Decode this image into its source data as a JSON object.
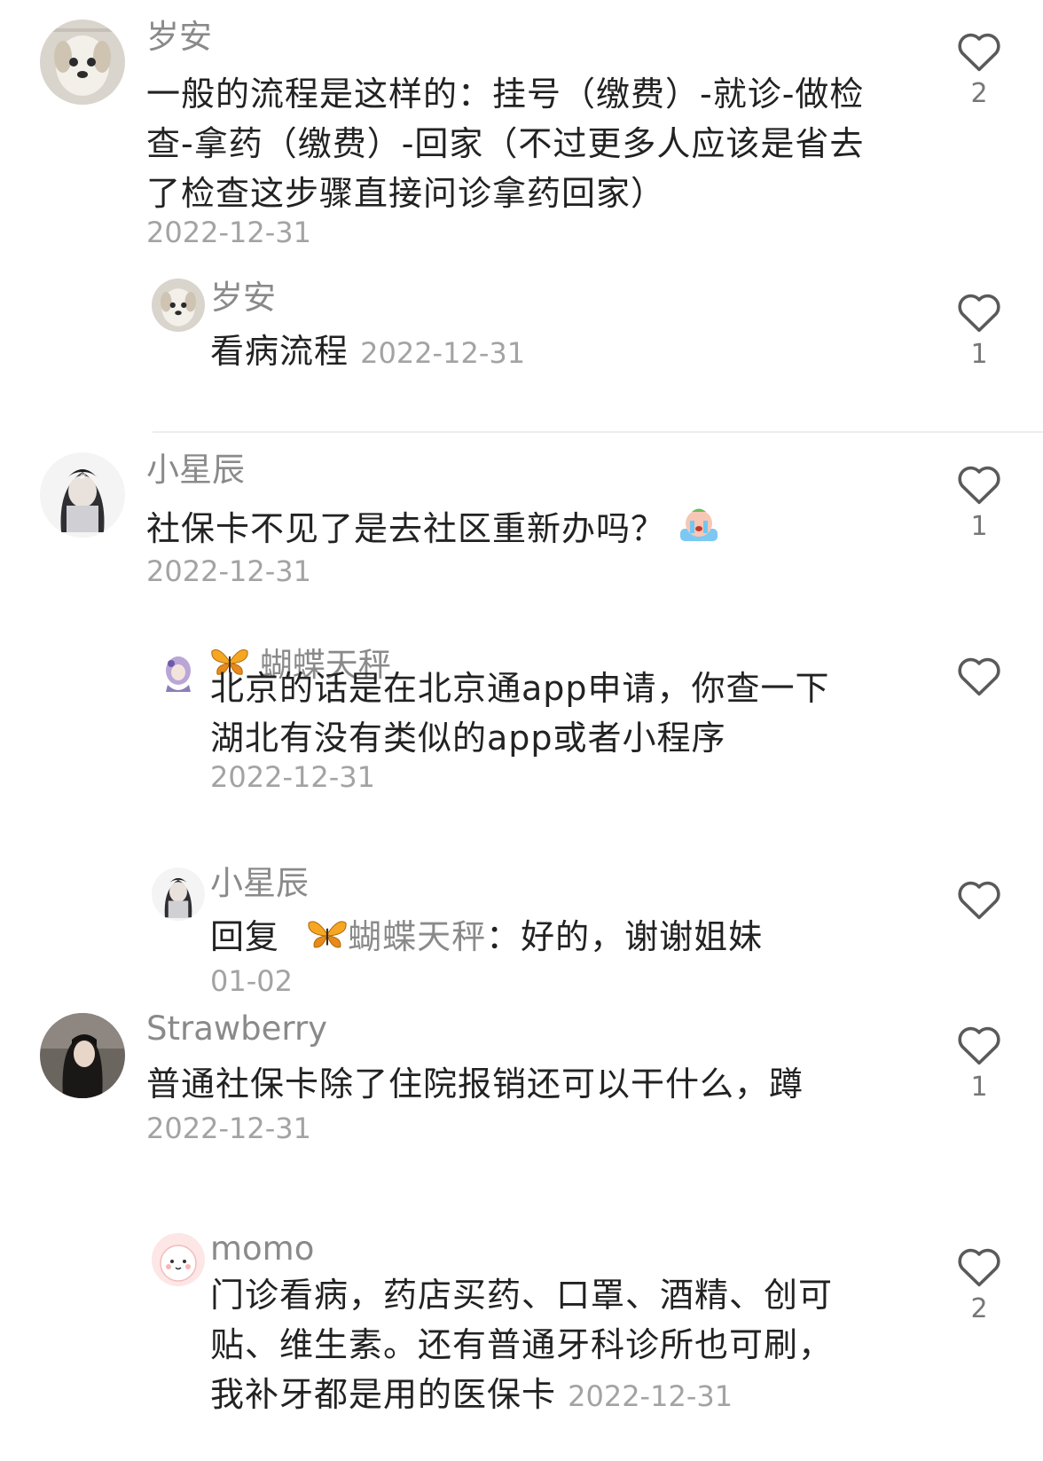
{
  "comments": [
    {
      "user": "岁安",
      "text": "一般的流程是这样的：挂号（缴费）-就诊-做检查-拿药（缴费）-回家（不过更多人应该是省去了检查这步骤直接问诊拿药回家）",
      "date": "2022-12-31",
      "likes": "2",
      "reply": {
        "user": "岁安",
        "text": "看病流程",
        "date": "2022-12-31",
        "likes": "1"
      }
    },
    {
      "user": "小星辰",
      "text": "社保卡不见了是去社区重新办吗？",
      "date": "2022-12-31",
      "likes": "1",
      "replies": [
        {
          "user": "蝴蝶天秤",
          "text": "北京的话是在北京通app申请，你查一下湖北有没有类似的app或者小程序",
          "date": "2022-12-31"
        },
        {
          "user": "小星辰",
          "reply_prefix": "回复",
          "mention": "蝴蝶天秤",
          "text": "：好的，谢谢姐妹",
          "date": "01-02"
        }
      ]
    },
    {
      "user": "Strawberry",
      "text": "普通社保卡除了住院报销还可以干什么，蹲",
      "date": "2022-12-31",
      "likes": "1",
      "reply": {
        "user": "momo",
        "text": "门诊看病，药店买药、口罩、酒精、创可贴、维生素。还有普通牙科诊所也可刷，我补牙都是用的医保卡",
        "date": "2022-12-31",
        "likes": "2"
      }
    }
  ],
  "icons": {
    "like": "heart-outline-icon",
    "butterfly": "butterfly-emoji-icon",
    "crying": "crying-emoji-icon"
  },
  "colors": {
    "text": "#222222",
    "meta": "#8a8a8a",
    "date": "#a3a3a3",
    "divider": "#ededed"
  }
}
